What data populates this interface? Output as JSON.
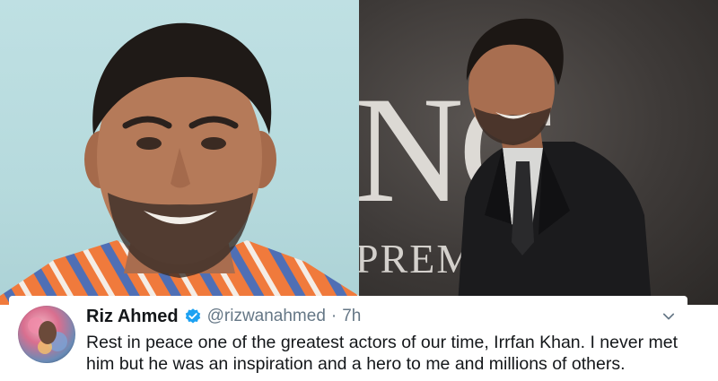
{
  "tweet": {
    "display_name": "Riz Ahmed",
    "verified": true,
    "handle": "@rizwanahmed",
    "separator": "·",
    "time": "7h",
    "text": "Rest in peace one of the greatest actors of our time, Irrfan Khan. I never met him but he was an inspiration and a hero to me and millions of others."
  },
  "photo_right": {
    "backdrop_big": "NC",
    "backdrop_small": "PREMIEI"
  },
  "colors": {
    "verified_blue": "#1da1f2",
    "text_primary": "#14171a",
    "text_secondary": "#657786"
  },
  "icons": {
    "verified": "verified-badge-icon",
    "menu": "chevron-down-icon"
  }
}
